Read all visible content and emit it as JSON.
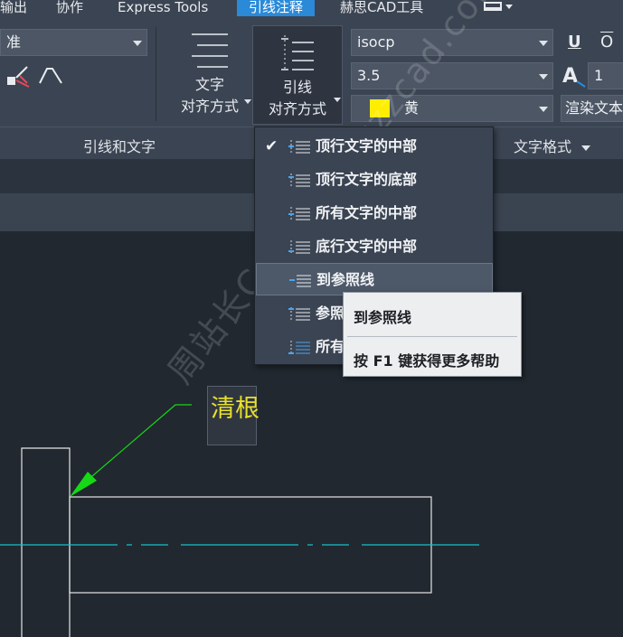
{
  "tabs": [
    {
      "label": "输出",
      "active": false
    },
    {
      "label": "协作",
      "active": false
    },
    {
      "label": "Express Tools",
      "active": false
    },
    {
      "label": "引线注释",
      "active": true
    },
    {
      "label": "赫思CAD工具",
      "active": false
    }
  ],
  "ribbon": {
    "panel_leader_text": "引线和文字",
    "panel_text_format": "文字格式",
    "partial_combo": "准",
    "text_align_button": {
      "line1": "文字",
      "line2": "对齐方式"
    },
    "leader_align_button": {
      "line1": "引线",
      "line2": "对齐方式"
    },
    "text_style": "isocp",
    "text_height": "3.5",
    "text_color": {
      "label": "黄",
      "swatch": "#ffee00"
    },
    "width_value": "1",
    "render_text": "渲染文本",
    "underline_label": "U",
    "overline_label": "O"
  },
  "dropdown": {
    "items": [
      {
        "label": "顶行文字的中部",
        "checked": true
      },
      {
        "label": "顶行文字的底部",
        "checked": false
      },
      {
        "label": "所有文字的中部",
        "checked": false
      },
      {
        "label": "底行文字的中部",
        "checked": false
      },
      {
        "label": "到参照线",
        "checked": false,
        "hover": true
      },
      {
        "label": "参照",
        "checked": false
      },
      {
        "label": "所有",
        "checked": false
      }
    ]
  },
  "tooltip": {
    "title": "到参照线",
    "help": "按 F1 键获得更多帮助"
  },
  "canvas": {
    "mtext": "清根"
  },
  "watermark": "周站长CAD www.zzzcad.com",
  "colors": {
    "active_tab": "#2a8ad8",
    "leader": "#16d816",
    "centerline": "#18c0c8",
    "mtext": "#e9e02a",
    "geometry": "#e6e6e6"
  }
}
